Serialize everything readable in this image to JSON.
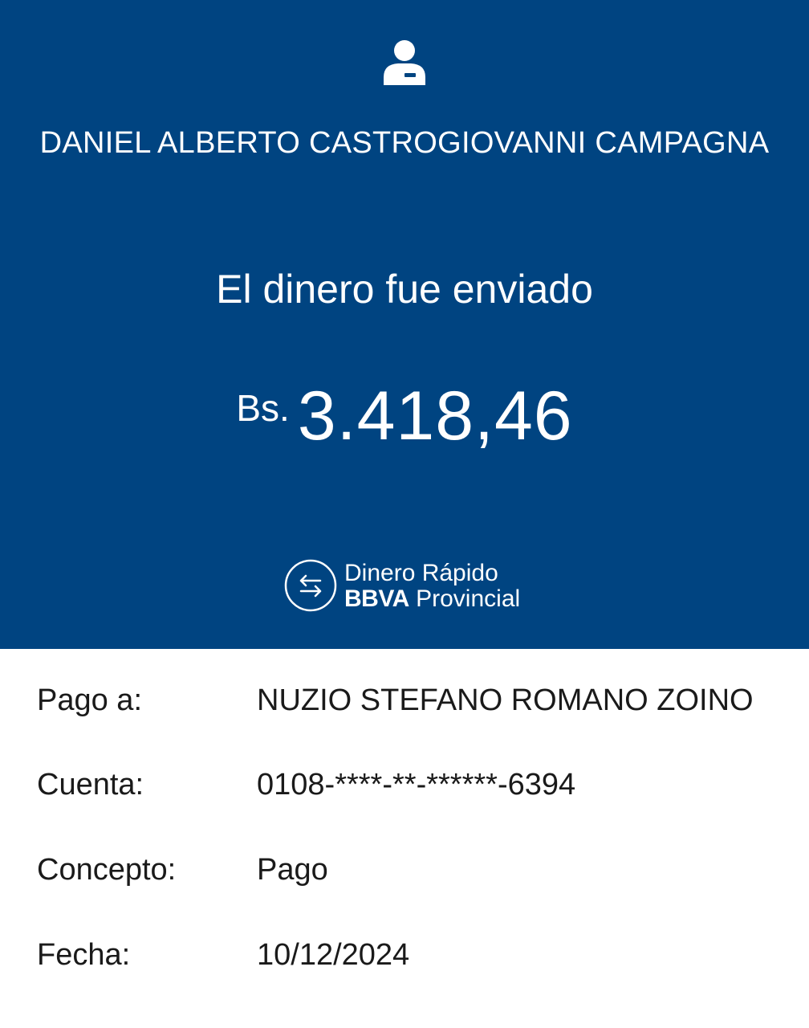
{
  "header": {
    "avatar_icon": "user-icon",
    "sender_name": "DANIEL ALBERTO CASTROGIOVANNI CAMPAGNA",
    "status": "El dinero fue enviado",
    "currency": "Bs.",
    "amount": "3.418,46",
    "brand": {
      "icon": "transfer-arrows-icon",
      "line1": "Dinero Rápido",
      "line2_bold": "BBVA",
      "line2_regular": "Provincial"
    }
  },
  "details": [
    {
      "label": "Pago a:",
      "value": "NUZIO STEFANO ROMANO ZOINO"
    },
    {
      "label": "Cuenta:",
      "value": "0108-****-**-******-6394"
    },
    {
      "label": "Concepto:",
      "value": "Pago"
    },
    {
      "label": "Fecha:",
      "value": "10/12/2024"
    }
  ],
  "colors": {
    "header_bg": "#004481",
    "header_text": "#ffffff",
    "body_text": "#1a1a1a"
  }
}
